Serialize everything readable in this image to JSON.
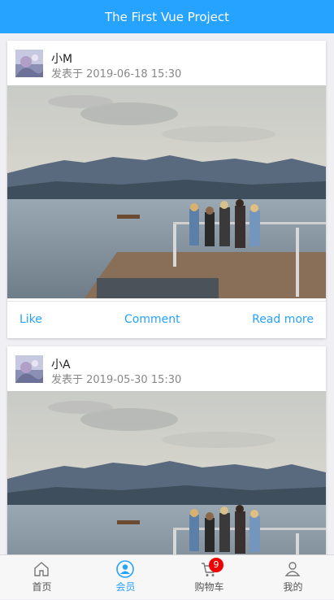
{
  "header": {
    "title": "The First Vue Project"
  },
  "posts": [
    {
      "author": "小M",
      "time": "发表于 2019-06-18 15:30",
      "like": "Like",
      "comment": "Comment",
      "read_more": "Read more"
    },
    {
      "author": "小A",
      "time": "发表于 2019-05-30 15:30"
    }
  ],
  "tabbar": {
    "tabs": [
      {
        "label": "首页",
        "icon": "home-icon"
      },
      {
        "label": "会员",
        "icon": "member-icon",
        "active": true
      },
      {
        "label": "购物车",
        "icon": "cart-icon",
        "badge": "9"
      },
      {
        "label": "我的",
        "icon": "person-icon"
      }
    ]
  },
  "colors": {
    "accent": "#26a2ff",
    "badge": "#ef0000",
    "background": "#efeff4"
  }
}
